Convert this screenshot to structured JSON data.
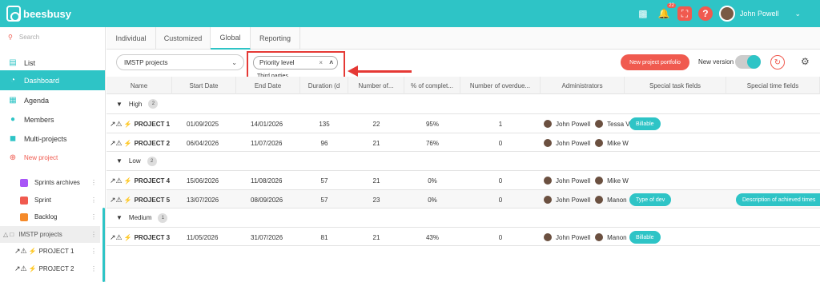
{
  "brand": {
    "name": "beesbusy"
  },
  "topbar": {
    "notif_count": "22",
    "user_name": "John Powell"
  },
  "sidebar": {
    "search_placeholder": "Search",
    "items": [
      {
        "label": "List"
      },
      {
        "label": "Dashboard"
      },
      {
        "label": "Agenda"
      },
      {
        "label": "Members"
      },
      {
        "label": "Multi-projects"
      },
      {
        "label": "New project"
      }
    ],
    "sub_items": [
      {
        "label": "Sprints archives",
        "color": "#a855f7"
      },
      {
        "label": "Sprint",
        "color": "#f05a4f"
      },
      {
        "label": "Backlog",
        "color": "#f58a2a"
      },
      {
        "label": "IMSTP projects"
      },
      {
        "label": "PROJECT 1"
      },
      {
        "label": "PROJECT 2"
      }
    ]
  },
  "tabs": [
    {
      "label": "Individual"
    },
    {
      "label": "Customized"
    },
    {
      "label": "Global"
    },
    {
      "label": "Reporting"
    }
  ],
  "filters": {
    "portfolio_select": "IMSTP projects",
    "group_select": "Priority level",
    "dropdown_option": "Third parties"
  },
  "actions": {
    "new_portfolio_label": "New project portfolio",
    "new_version_label": "New version"
  },
  "table": {
    "headers": [
      "Name",
      "Start Date",
      "End Date",
      "Duration (d",
      "Number of...",
      "% of complet...",
      "Number of overdue...",
      "Administrators",
      "Special task fields",
      "Special time fields"
    ],
    "groups": [
      {
        "label": "High",
        "count": "2"
      },
      {
        "label": "Low",
        "count": "2"
      },
      {
        "label": "Medium",
        "count": "1"
      }
    ],
    "rows": [
      {
        "name": "PROJECT 1",
        "start": "01/09/2025",
        "end": "14/01/2026",
        "duration": "135",
        "number": "22",
        "complete": "95%",
        "overdue": "1",
        "admin1": "John Powell",
        "admin2": "Tessa V",
        "task_field": "Billable",
        "time_field": ""
      },
      {
        "name": "PROJECT 2",
        "start": "06/04/2026",
        "end": "11/07/2026",
        "duration": "96",
        "number": "21",
        "complete": "76%",
        "overdue": "0",
        "admin1": "John Powell",
        "admin2": "Mike W",
        "task_field": "",
        "time_field": ""
      },
      {
        "name": "PROJECT 4",
        "start": "15/06/2026",
        "end": "11/08/2026",
        "duration": "57",
        "number": "21",
        "complete": "0%",
        "overdue": "0",
        "admin1": "John Powell",
        "admin2": "Mike W",
        "task_field": "",
        "time_field": ""
      },
      {
        "name": "PROJECT 5",
        "start": "13/07/2026",
        "end": "08/09/2026",
        "duration": "57",
        "number": "23",
        "complete": "0%",
        "overdue": "0",
        "admin1": "John Powell",
        "admin2": "Manon",
        "task_field": "Type of dev",
        "time_field": "Description of achieved times"
      },
      {
        "name": "PROJECT 3",
        "start": "11/05/2026",
        "end": "31/07/2026",
        "duration": "81",
        "number": "21",
        "complete": "43%",
        "overdue": "0",
        "admin1": "John Powell",
        "admin2": "Manon",
        "task_field": "Billable",
        "time_field": ""
      }
    ]
  },
  "colors": {
    "accent": "#2ec4c6",
    "danger": "#f05a4f",
    "annotation": "#e53935"
  }
}
